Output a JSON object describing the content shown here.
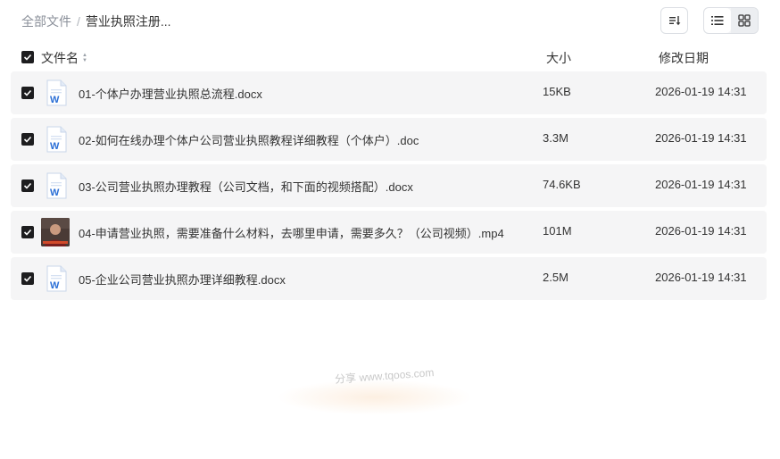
{
  "breadcrumb": {
    "root": "全部文件",
    "separator": "/",
    "current": "营业执照注册..."
  },
  "toolbar": {
    "sort_icon": "sort-icon",
    "list_view_icon": "list-view-icon",
    "grid_view_icon": "grid-view-icon"
  },
  "table": {
    "headers": {
      "name": "文件名",
      "size": "大小",
      "date": "修改日期"
    },
    "rows": [
      {
        "name": "01-个体户办理营业执照总流程.docx",
        "size": "15KB",
        "date": "2026-01-19 14:31",
        "type": "word-icon",
        "checked": true
      },
      {
        "name": "02-如何在线办理个体户公司营业执照教程详细教程（个体户）.doc",
        "size": "3.3M",
        "date": "2026-01-19 14:31",
        "type": "word-icon",
        "checked": true
      },
      {
        "name": "03-公司营业执照办理教程（公司文档，和下面的视频搭配）.docx",
        "size": "74.6KB",
        "date": "2026-01-19 14:31",
        "type": "word-icon",
        "checked": true
      },
      {
        "name": "04-申请营业执照，需要准备什么材料，去哪里申请，需要多久？（公司视频）.mp4",
        "size": "101M",
        "date": "2026-01-19 14:31",
        "type": "video-thumbnail",
        "checked": true
      },
      {
        "name": "05-企业公司营业执照办理详细教程.docx",
        "size": "2.5M",
        "date": "2026-01-19 14:31",
        "type": "word-icon",
        "checked": true
      }
    ]
  },
  "watermark": "分享 www.tqoos.com",
  "colors": {
    "row_bg": "#f5f5f6",
    "checkbox": "#1d1d1f",
    "word_blue": "#2b6fd6"
  }
}
